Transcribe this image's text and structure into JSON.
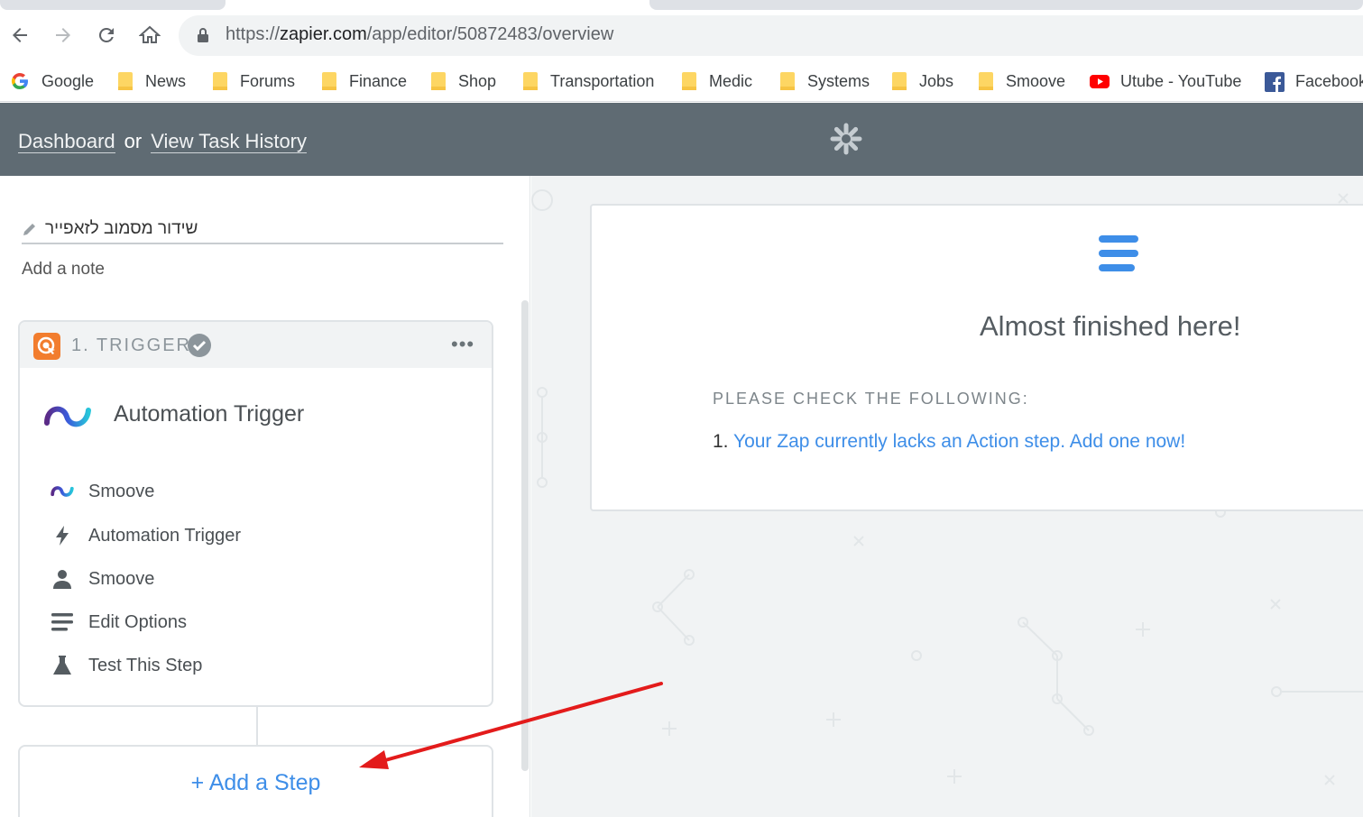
{
  "browser": {
    "url_prefix": "https://",
    "url_host": "zapier.com",
    "url_path": "/app/editor/50872483/overview"
  },
  "bookmarks": [
    {
      "label": "Google",
      "icon": "google-icon"
    },
    {
      "label": "News",
      "icon": "folder-icon"
    },
    {
      "label": "Forums",
      "icon": "folder-icon"
    },
    {
      "label": "Finance",
      "icon": "folder-icon"
    },
    {
      "label": "Shop",
      "icon": "folder-icon"
    },
    {
      "label": "Transportation",
      "icon": "folder-icon"
    },
    {
      "label": "Medic",
      "icon": "folder-icon"
    },
    {
      "label": "Systems",
      "icon": "folder-icon"
    },
    {
      "label": "Jobs",
      "icon": "folder-icon"
    },
    {
      "label": "Smoove",
      "icon": "folder-icon"
    },
    {
      "label": "Utube - YouTube",
      "icon": "youtube-icon"
    },
    {
      "label": "Facebook",
      "icon": "facebook-icon"
    }
  ],
  "header": {
    "dashboard_label": "Dashboard",
    "or_label": "or",
    "history_label": "View Task History"
  },
  "zap": {
    "name": "שידור מסמוב לזאפייר",
    "add_note_label": "Add a note"
  },
  "trigger_card": {
    "step_label": "1. TRIGGER",
    "title": "Automation Trigger",
    "menu_label": "•••",
    "items": [
      {
        "label": "Smoove",
        "icon": "smoove-icon"
      },
      {
        "label": "Automation Trigger",
        "icon": "bolt-icon"
      },
      {
        "label": "Smoove",
        "icon": "user-icon"
      },
      {
        "label": "Edit Options",
        "icon": "lines-icon"
      },
      {
        "label": "Test This Step",
        "icon": "flask-icon"
      }
    ]
  },
  "add_step": {
    "label": "+ Add a Step"
  },
  "notice": {
    "title": "Almost finished here!",
    "subtitle": "PLEASE CHECK THE FOLLOWING:",
    "item_number": "1.",
    "item_link": "Your Zap currently lacks an Action step. Add one now!"
  },
  "colors": {
    "header_bg": "#5f6b73",
    "link_blue": "#3e8ee8",
    "annotation_arrow": "#e31b1b"
  }
}
